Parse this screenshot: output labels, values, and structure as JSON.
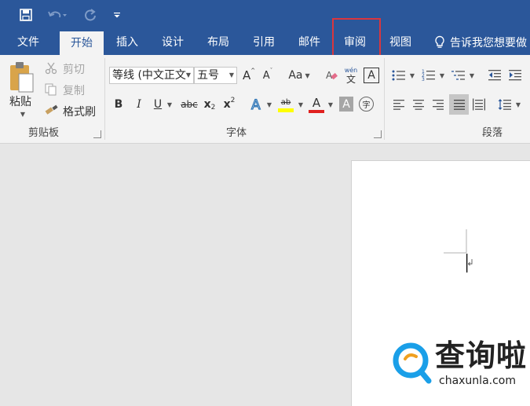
{
  "quick_access": {
    "icons": [
      "save-icon",
      "undo-icon",
      "redo-icon",
      "customize-icon"
    ]
  },
  "tabs": [
    {
      "label": "文件"
    },
    {
      "label": "开始",
      "active": true
    },
    {
      "label": "插入"
    },
    {
      "label": "设计"
    },
    {
      "label": "布局"
    },
    {
      "label": "引用"
    },
    {
      "label": "邮件"
    },
    {
      "label": "审阅",
      "highlighted": true
    },
    {
      "label": "视图"
    }
  ],
  "tell_me": "告诉我您想要做",
  "clipboard": {
    "paste": "粘贴",
    "cut": "剪切",
    "copy": "复制",
    "format_painter": "格式刷",
    "group_label": "剪贴板"
  },
  "font": {
    "family": "等线 (中文正文",
    "size": "五号",
    "group_label": "字体",
    "change_case": "Aa",
    "phonetic_top": "wén",
    "phonetic_bottom": "文",
    "border_char": "A",
    "enclose_char": "字",
    "bold": "B",
    "italic": "I",
    "underline": "U",
    "strike": "abc",
    "sub": "x",
    "sub_mark": "2",
    "sup": "x",
    "sup_mark": "2",
    "highlight_label": "ab",
    "font_color_label": "A",
    "shading_label": "A",
    "grow": "A",
    "shrink": "A"
  },
  "paragraph": {
    "group_label": "段落"
  },
  "colors": {
    "title_bar": "#2b579a",
    "ribbon": "#f3f3f3",
    "highlight_box": "#d9363e",
    "highlight_yellow": "#ffff00",
    "font_red": "#e0201e"
  },
  "watermark": {
    "name": "查询啦",
    "domain": "chaxunla.com"
  }
}
